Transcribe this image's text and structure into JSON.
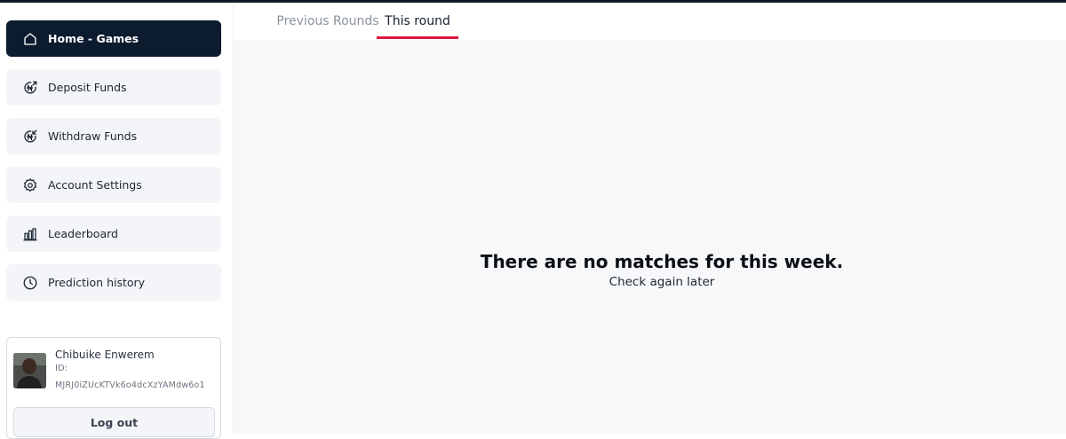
{
  "sidebar": {
    "items": [
      {
        "label": "Home - Games",
        "icon": "home-icon",
        "active": true
      },
      {
        "label": "Deposit Funds",
        "icon": "naira-deposit-icon"
      },
      {
        "label": "Withdraw Funds",
        "icon": "naira-withdraw-icon"
      },
      {
        "label": "Account Settings",
        "icon": "gear-icon"
      },
      {
        "label": "Leaderboard",
        "icon": "bar-chart-icon"
      },
      {
        "label": "Prediction history",
        "icon": "clock-icon"
      }
    ],
    "profile": {
      "name": "Chibuike Enwerem",
      "id_label": "ID:",
      "id_value": "MJRJ0iZUcKTVk6o4dcXzYAMdw6o1",
      "logout_label": "Log out"
    }
  },
  "tabs": [
    {
      "label": "Previous Rounds",
      "active": false
    },
    {
      "label": "This round",
      "active": true
    }
  ],
  "main": {
    "empty_title": "There are no matches for this week.",
    "empty_subtitle": "Check again later"
  },
  "colors": {
    "active_nav": "#0d1b2f",
    "accent_underline": "#e0163f",
    "nav_bg": "#f3f5f8",
    "content_bg": "#f7f8fa"
  }
}
